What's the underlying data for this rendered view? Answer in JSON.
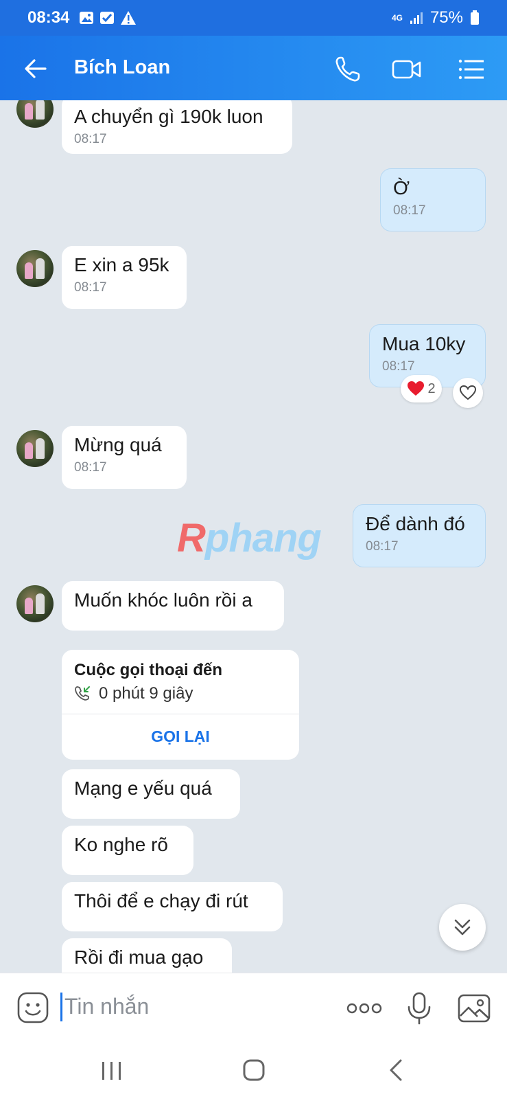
{
  "status_bar": {
    "time": "08:34",
    "network": "4G",
    "battery": "75%"
  },
  "header": {
    "title": "Bích Loan"
  },
  "messages": [
    {
      "text": "A chuyển gì 190k luon",
      "time": "08:17"
    },
    {
      "text": "Ờ",
      "time": "08:17"
    },
    {
      "text": "E xin a 95k",
      "time": "08:17"
    },
    {
      "text": "Mua 10ky",
      "time": "08:17",
      "reaction_count": "2"
    },
    {
      "text": "Mừng quá",
      "time": "08:17"
    },
    {
      "text": "Để dành đó",
      "time": "08:17"
    },
    {
      "text": "Muốn khóc luôn rồi a"
    },
    {
      "text": "Mạng e yếu quá"
    },
    {
      "text": "Ko nghe rõ"
    },
    {
      "text": "Thôi để e chạy đi rút"
    },
    {
      "text": "Rồi đi mua gạo"
    }
  ],
  "call_card": {
    "title": "Cuộc gọi thoại đến",
    "duration": "0 phút 9 giây",
    "action": "GỌI LẠI"
  },
  "watermark": {
    "first": "R",
    "rest": "phang"
  },
  "input": {
    "placeholder": "Tin nhắn"
  },
  "colors": {
    "header": "#1a73e8",
    "bubble_out": "#d5ebfc",
    "bubble_in": "#ffffff",
    "background": "#e1e7ed"
  }
}
